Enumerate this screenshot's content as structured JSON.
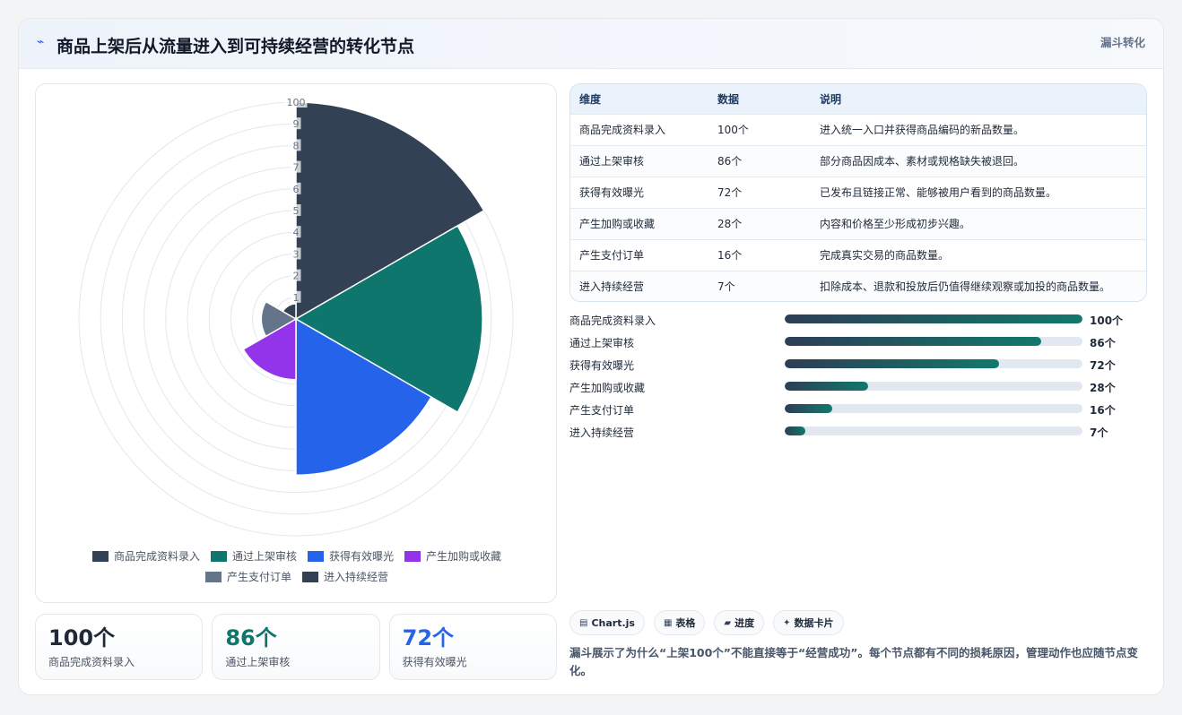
{
  "header": {
    "title": "商品上架后从流量进入到可持续经营的转化节点",
    "tag": "漏斗转化",
    "icon": "trend-icon"
  },
  "chart_data": {
    "type": "polarArea",
    "title": "",
    "categories": [
      "商品完成资料录入",
      "通过上架审核",
      "获得有效曝光",
      "产生加购或收藏",
      "产生支付订单",
      "进入持续经营"
    ],
    "values": [
      100,
      86,
      72,
      28,
      16,
      7
    ],
    "colors": [
      "#334155",
      "#0f766e",
      "#2563eb",
      "#9333ea",
      "#64748b",
      "#334155"
    ],
    "r_ticks": [
      "1",
      "2",
      "3",
      "4",
      "5",
      "6",
      "7",
      "8",
      "9",
      "100"
    ],
    "rlim": [
      0,
      100
    ],
    "grid": true,
    "legend_position": "bottom"
  },
  "kpis": [
    {
      "value": "100个",
      "label": "商品完成资料录入",
      "color": "#1f2937"
    },
    {
      "value": "86个",
      "label": "通过上架审核",
      "color": "#0f766e"
    },
    {
      "value": "72个",
      "label": "获得有效曝光",
      "color": "#2563eb"
    }
  ],
  "table": {
    "headers": [
      "维度",
      "数据",
      "说明"
    ],
    "rows": [
      [
        "商品完成资料录入",
        "100个",
        "进入统一入口并获得商品编码的新品数量。"
      ],
      [
        "通过上架审核",
        "86个",
        "部分商品因成本、素材或规格缺失被退回。"
      ],
      [
        "获得有效曝光",
        "72个",
        "已发布且链接正常、能够被用户看到的商品数量。"
      ],
      [
        "产生加购或收藏",
        "28个",
        "内容和价格至少形成初步兴趣。"
      ],
      [
        "产生支付订单",
        "16个",
        "完成真实交易的商品数量。"
      ],
      [
        "进入持续经营",
        "7个",
        "扣除成本、退款和投放后仍值得继续观察或加投的商品数量。"
      ]
    ]
  },
  "progress": [
    {
      "label": "商品完成资料录入",
      "value": 100,
      "display": "100个"
    },
    {
      "label": "通过上架审核",
      "value": 86,
      "display": "86个"
    },
    {
      "label": "获得有效曝光",
      "value": 72,
      "display": "72个"
    },
    {
      "label": "产生加购或收藏",
      "value": 28,
      "display": "28个"
    },
    {
      "label": "产生支付订单",
      "value": 16,
      "display": "16个"
    },
    {
      "label": "进入持续经营",
      "value": 7,
      "display": "7个"
    }
  ],
  "chips": [
    {
      "icon": "chart-icon",
      "glyph": "▤",
      "label": "Chart.js"
    },
    {
      "icon": "table-icon",
      "glyph": "▦",
      "label": "表格"
    },
    {
      "icon": "progress-icon",
      "glyph": "▰",
      "label": "进度"
    },
    {
      "icon": "card-icon",
      "glyph": "✦",
      "label": "数据卡片"
    }
  ],
  "summary": "漏斗展示了为什么“上架100个”不能直接等于“经营成功”。每个节点都有不同的损耗原因，管理动作也应随节点变化。"
}
